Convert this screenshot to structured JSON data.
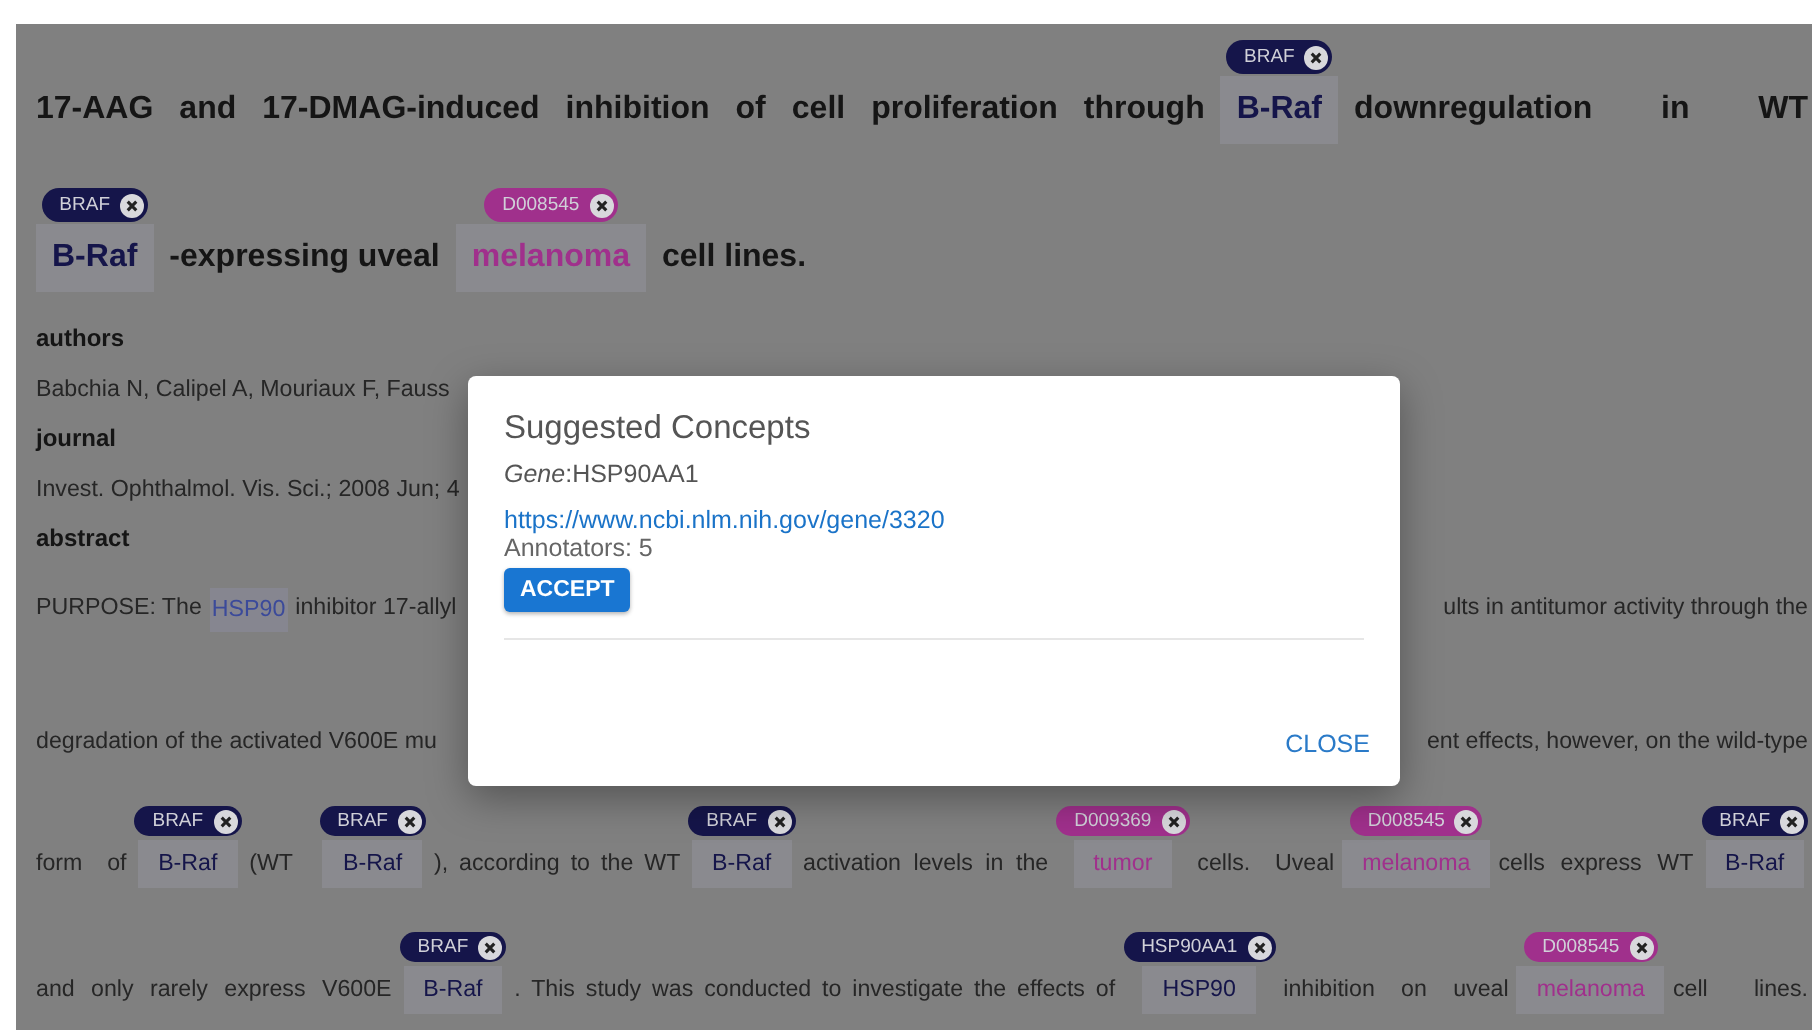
{
  "title_lines": [
    {
      "parts": [
        [
          {
            "kind": "text",
            "text": "17-AAG and 17-DMAG-induced inhibition of cell proliferation through"
          },
          {
            "kind": "annotated",
            "text": "B-Raf",
            "tag": "BRAF",
            "color": "#15154a"
          },
          {
            "kind": "text",
            "text": "downregulation in WT"
          }
        ]
      ]
    },
    {
      "parts": [
        [
          {
            "kind": "annotated",
            "text": "B-Raf",
            "tag": "BRAF",
            "color": "#15154a"
          },
          {
            "kind": "text",
            "text": "-expressing uveal"
          },
          {
            "kind": "annotated",
            "text": "melanoma",
            "tag": "D008545",
            "color": "#a0308c"
          },
          {
            "kind": "text",
            "text": "cell lines."
          }
        ]
      ]
    }
  ],
  "fields": [
    {
      "label": "authors",
      "value": "Babchia N, Calipel A, Mouriaux F, Fauss"
    },
    {
      "label": "journal",
      "value": "Invest. Ophthalmol. Vis. Sci.; 2008 Jun; 4"
    }
  ],
  "abstract_label": "abstract",
  "abstract_lines": [
    {
      "parts": [
        [
          {
            "kind": "text",
            "text": "PURPOSE: The"
          },
          {
            "kind": "highlight",
            "text": "HSP90"
          },
          {
            "kind": "text",
            "text": "inhibitor 17-allyl"
          }
        ],
        [
          {
            "kind": "text",
            "text": "ults in antitumor activity through the"
          }
        ]
      ]
    },
    {
      "parts": [
        [
          {
            "kind": "text",
            "text": "degradation of the activated V600E mu"
          }
        ],
        [
          {
            "kind": "text",
            "text": "ent effects, however, on the wild-type"
          }
        ]
      ]
    },
    {
      "parts": [
        [
          {
            "kind": "text",
            "text": "form of"
          },
          {
            "kind": "annotated",
            "text": "B-Raf",
            "tag": "BRAF",
            "color": "#15154a"
          },
          {
            "kind": "text",
            "text": "(WT"
          },
          {
            "kind": "annotated",
            "text": "B-Raf",
            "tag": "BRAF",
            "color": "#15154a"
          },
          {
            "kind": "text",
            "text": "), according to the WT"
          },
          {
            "kind": "annotated",
            "text": "B-Raf",
            "tag": "BRAF",
            "color": "#15154a"
          },
          {
            "kind": "text",
            "text": "activation levels in the"
          },
          {
            "kind": "annotated",
            "text": "tumor",
            "tag": "D009369",
            "color": "#a0308c"
          },
          {
            "kind": "text",
            "text": "cells. Uveal"
          },
          {
            "kind": "annotated",
            "text": "melanoma",
            "tag": "D008545",
            "color": "#a0308c"
          },
          {
            "kind": "text",
            "text": "cells express WT"
          },
          {
            "kind": "annotated",
            "text": "B-Raf",
            "tag": "BRAF",
            "color": "#15154a"
          }
        ]
      ]
    },
    {
      "parts": [
        [
          {
            "kind": "text",
            "text": "and only rarely express V600E"
          },
          {
            "kind": "annotated",
            "text": "B-Raf",
            "tag": "BRAF",
            "color": "#15154a"
          },
          {
            "kind": "text",
            "text": ". This study was conducted to investigate the effects of"
          },
          {
            "kind": "annotated",
            "text": "HSP90",
            "tag": "HSP90AA1",
            "color": "#15154a"
          },
          {
            "kind": "text",
            "text": "inhibition on uveal"
          },
          {
            "kind": "annotated",
            "text": "melanoma",
            "tag": "D008545",
            "color": "#a0308c"
          },
          {
            "kind": "text",
            "text": "cell lines."
          }
        ]
      ]
    }
  ],
  "dialog": {
    "title": "Suggested Concepts",
    "concept": "*Gene*:HSP90AA1",
    "link": "https://www.ncbi.nlm.nih.gov/gene/3320",
    "annotators": "Annotators: 5",
    "accept": "ACCEPT",
    "close": "CLOSE"
  }
}
